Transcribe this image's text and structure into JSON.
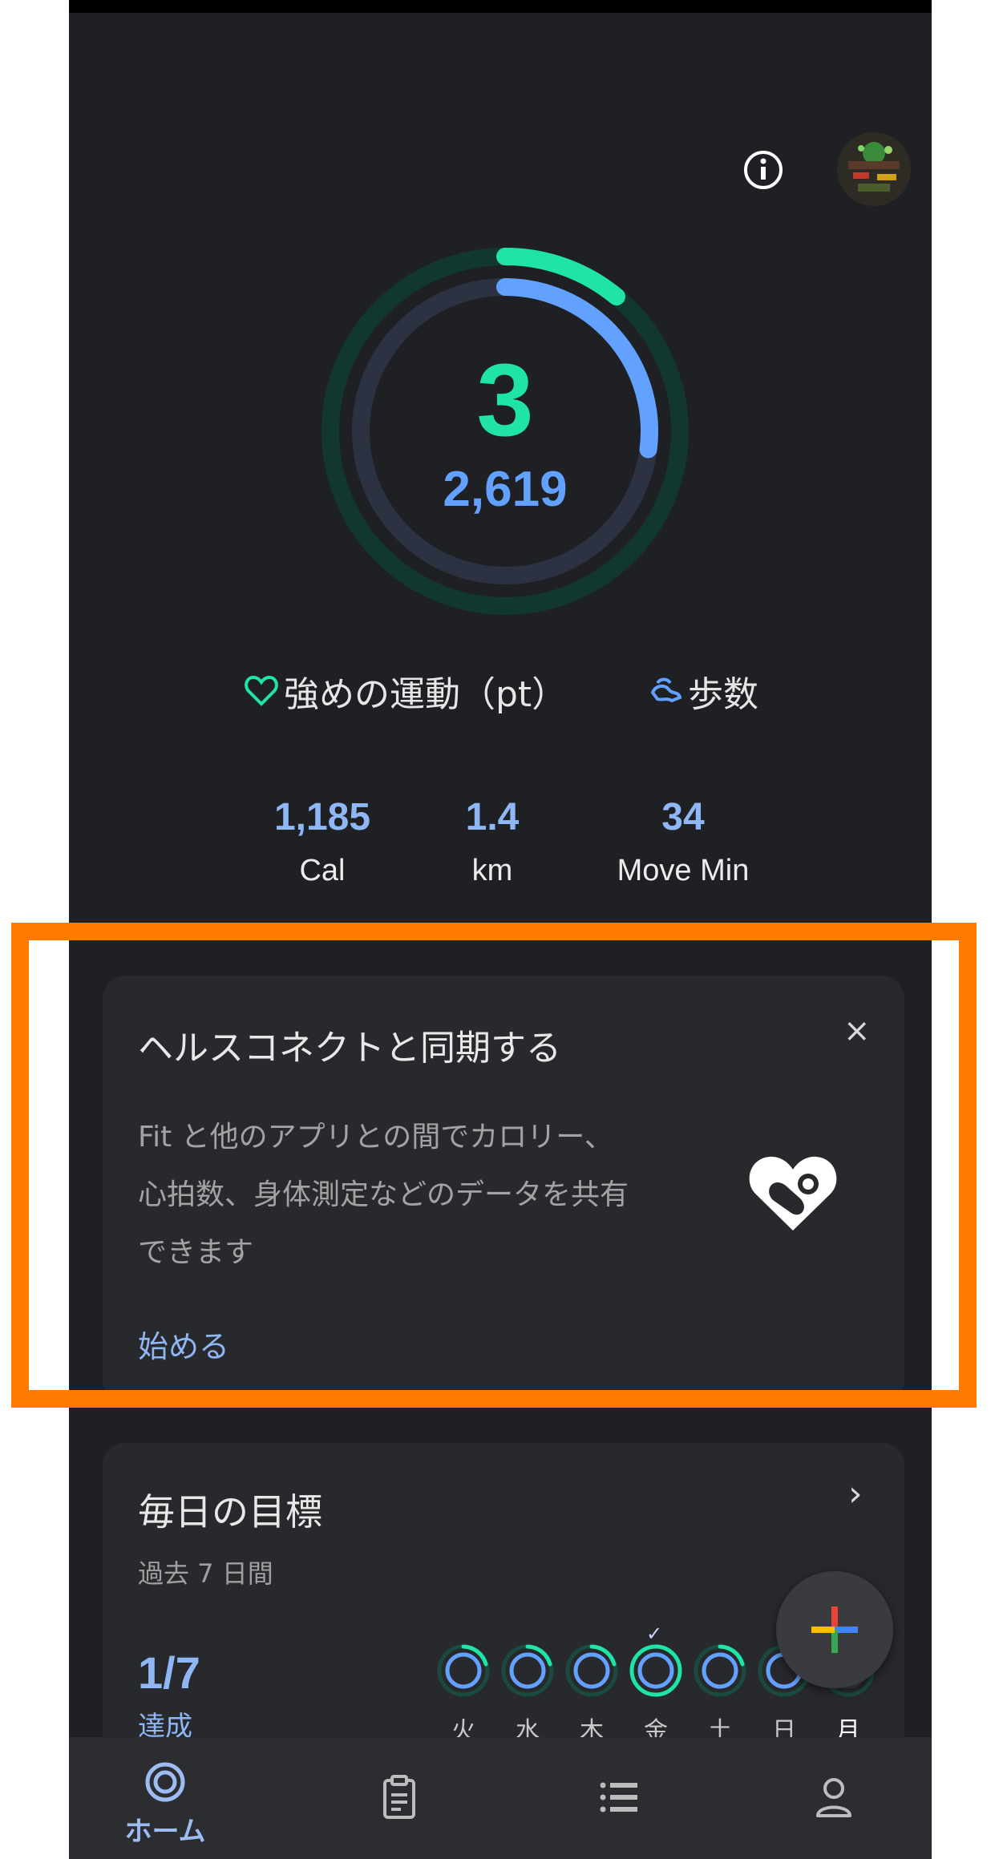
{
  "ring": {
    "heart_points": "3",
    "steps": "2,619",
    "heart_progress": 0.11,
    "steps_progress": 0.27
  },
  "legend": {
    "heart_label": "強めの運動（pt）",
    "steps_label": "歩数"
  },
  "stats": [
    {
      "value": "1,185",
      "label": "Cal"
    },
    {
      "value": "1.4",
      "label": "km"
    },
    {
      "value": "34",
      "label": "Move Min"
    }
  ],
  "health_connect_card": {
    "title": "ヘルスコネクトと同期する",
    "close": "×",
    "body_lines": [
      "Fit と他のアプリとの間でカロリー、",
      "心拍数、身体測定などのデータを共有",
      "できます"
    ],
    "cta": "始める"
  },
  "daily_goals": {
    "title": "毎日の目標",
    "chevron": "›",
    "subtitle": "過去 7 日間",
    "achieved_count": "1/7",
    "achieved_label": "達成",
    "days": [
      {
        "label": "火",
        "achieved": false
      },
      {
        "label": "水",
        "achieved": false
      },
      {
        "label": "木",
        "achieved": false
      },
      {
        "label": "金",
        "achieved": true
      },
      {
        "label": "土",
        "achieved": false
      },
      {
        "label": "日",
        "achieved": false
      },
      {
        "label": "月",
        "achieved": false
      }
    ]
  },
  "nav": {
    "home_label": "ホーム",
    "items": [
      "home-icon",
      "journal-icon",
      "browse-icon",
      "profile-icon"
    ]
  },
  "colors": {
    "background": "#1f2024",
    "card": "#28292d",
    "heart_green": "#1fe3a7",
    "steps_blue": "#63a1ff",
    "highlight": "#ff7a00"
  }
}
